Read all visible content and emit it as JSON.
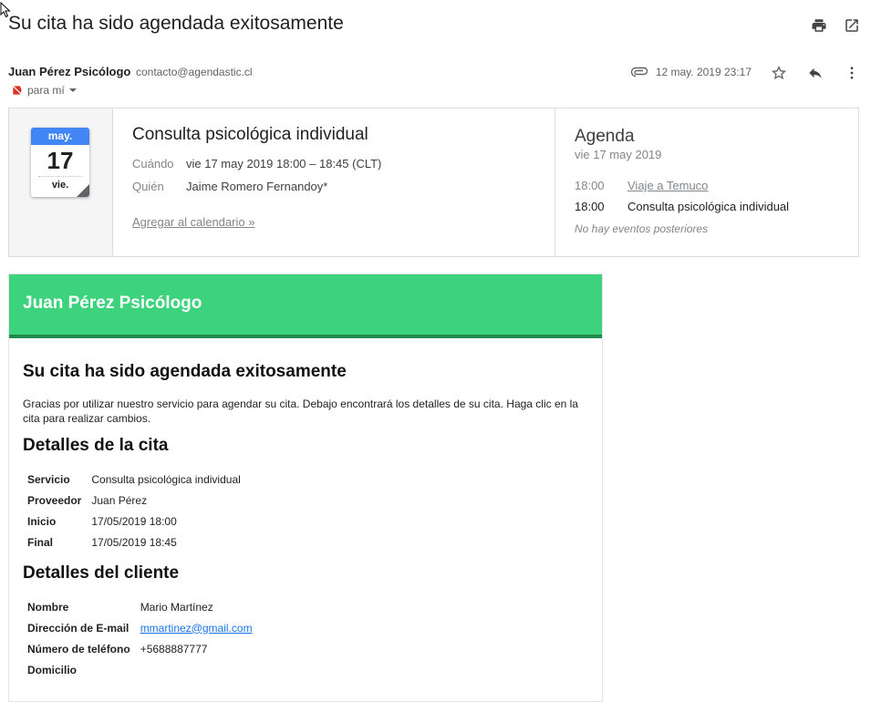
{
  "subject": "Su cita ha sido agendada exitosamente",
  "toolbar": {
    "print_icon": "print-icon",
    "popout_icon": "open-in-new-window-icon"
  },
  "sender": {
    "name": "Juan Pérez Psicólogo",
    "email": "contacto@agendastic.cl",
    "to": "para mí"
  },
  "meta": {
    "date": "12 may. 2019 23:17"
  },
  "invite": {
    "month": "may.",
    "day": "17",
    "weekday": "vie.",
    "title": "Consulta psicológica individual",
    "when_label": "Cuándo",
    "when_value": "vie 17 may 2019 18:00 – 18:45 (CLT)",
    "who_label": "Quién",
    "who_value": "Jaime Romero Fernandoy*",
    "add_link": "Agregar al calendario »",
    "agenda_title": "Agenda",
    "agenda_date": "vie 17 may 2019",
    "agenda_items": [
      {
        "time": "18:00",
        "name": "Viaje a Temuco"
      },
      {
        "time": "18:00",
        "name": "Consulta psicológica individual"
      }
    ],
    "agenda_note": "No hay eventos posteriores"
  },
  "mail": {
    "header": "Juan Pérez Psicólogo",
    "title": "Su cita ha sido agendada exitosamente",
    "intro": "Gracias por utilizar nuestro servicio para agendar su cita. Debajo encontrará los detalles de su cita. Haga clic en la cita para realizar cambios.",
    "appointment_heading": "Detalles de la cita",
    "appointment": [
      {
        "label": "Servicio",
        "value": "Consulta psicológica individual"
      },
      {
        "label": "Proveedor",
        "value": "Juan Pérez"
      },
      {
        "label": "Inicio",
        "value": "17/05/2019 18:00"
      },
      {
        "label": "Final",
        "value": "17/05/2019 18:45"
      }
    ],
    "client_heading": "Detalles del cliente",
    "client": [
      {
        "label": "Nombre",
        "value": "Mario Martínez"
      },
      {
        "label": "Dirección de E-mail",
        "value": "mmartinez@gmail.com"
      },
      {
        "label": "Número de teléfono",
        "value": "+5688887777"
      },
      {
        "label": "Domicilio",
        "value": ""
      }
    ]
  },
  "colors": {
    "header_green": "#3dd37d",
    "header_border": "#1e8a4c",
    "calendar_blue": "#4285f4",
    "link_blue": "#1a73e8"
  }
}
